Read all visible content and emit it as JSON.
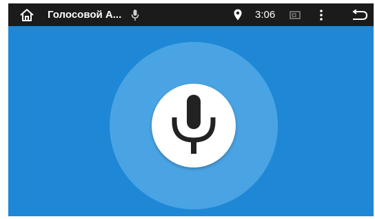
{
  "status_bar": {
    "app_title": "Голосовой А...",
    "time": "3:06"
  },
  "icons": {
    "home": "home-icon",
    "mic_small": "microphone-icon",
    "location": "location-pin-icon",
    "cast": "cast-icon",
    "menu": "more-vertical-icon",
    "back": "back-icon",
    "mic_large": "microphone-icon"
  },
  "colors": {
    "status_bar_bg": "#1b1b1b",
    "background": "#1e88d6",
    "halo": "#4aa3e3",
    "mic_button": "#ffffff",
    "mic_glyph": "#222222"
  }
}
